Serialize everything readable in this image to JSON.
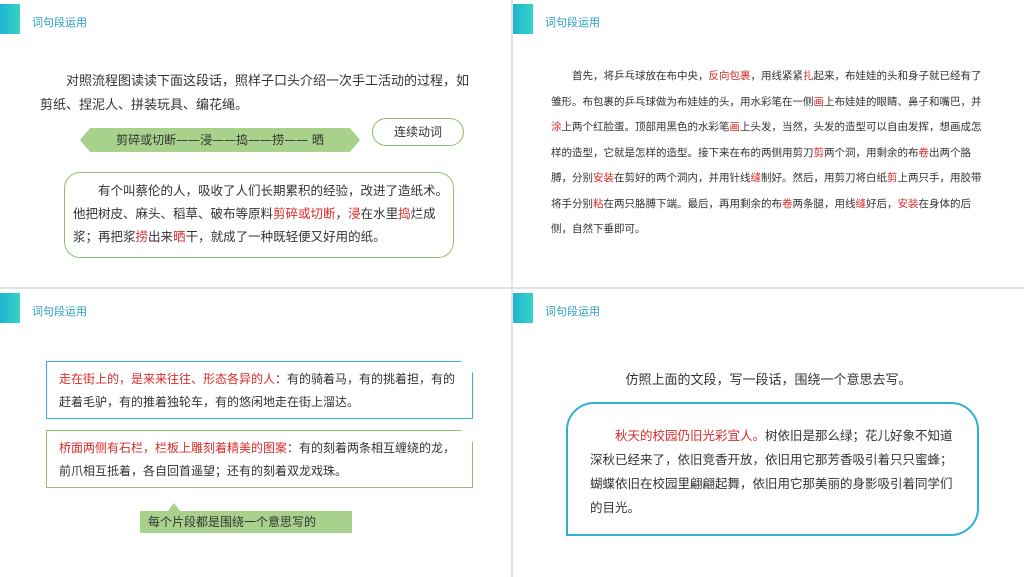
{
  "slide_title": "词句段运用",
  "s1": {
    "intro": "对照流程图读读下面这段话，照样子口头介绍一次手工活动的过程，如剪纸、捏泥人、拼装玩具、编花绳。",
    "flow": "剪碎或切断——浸——捣——捞—— 晒",
    "callout": "连续动词",
    "para": [
      {
        "t": "有个叫蔡伦的人，吸收了人们长期累积的经验，改进了造纸术。他把树皮、麻头、稻草、破布等原料",
        "r": false
      },
      {
        "t": "剪碎或切断",
        "r": true
      },
      {
        "t": "，",
        "r": false
      },
      {
        "t": "浸",
        "r": true
      },
      {
        "t": "在水里",
        "r": false
      },
      {
        "t": "捣",
        "r": true
      },
      {
        "t": "烂成浆；再把浆",
        "r": false
      },
      {
        "t": "捞",
        "r": true
      },
      {
        "t": "出来",
        "r": false
      },
      {
        "t": "晒",
        "r": true
      },
      {
        "t": "干，就成了一种既轻便又好用的纸。",
        "r": false
      }
    ]
  },
  "s2": {
    "para": [
      {
        "t": "首先，将乒乓球放在布中央，",
        "r": false
      },
      {
        "t": "反向包裹",
        "r": true
      },
      {
        "t": "，用线紧紧",
        "r": false
      },
      {
        "t": "扎",
        "r": true
      },
      {
        "t": "起来，布娃娃的头和身子就已经有了雏形。布包裹的乒乓球做为布娃娃的头，用水彩笔在一侧",
        "r": false
      },
      {
        "t": "画",
        "r": true
      },
      {
        "t": "上布娃娃的眼睛、鼻子和嘴巴，并",
        "r": false
      },
      {
        "t": "涂",
        "r": true
      },
      {
        "t": "上两个红脸蛋。顶部用黑色的水彩笔",
        "r": false
      },
      {
        "t": "画",
        "r": true
      },
      {
        "t": "上头发，当然，头发的造型可以自由发挥，想画成怎样的造型，它就是怎样的造型。接下来在布的两侧用剪刀",
        "r": false
      },
      {
        "t": "剪",
        "r": true
      },
      {
        "t": "两个洞，用剩余的布",
        "r": false
      },
      {
        "t": "卷",
        "r": true
      },
      {
        "t": "出两个胳膊，分别",
        "r": false
      },
      {
        "t": "安装",
        "r": true
      },
      {
        "t": "在剪好的两个洞内，并用针线",
        "r": false
      },
      {
        "t": "缝",
        "r": true
      },
      {
        "t": "制好。然后，用剪刀将白纸",
        "r": false
      },
      {
        "t": "剪",
        "r": true
      },
      {
        "t": "上两只手，用胶带将手分别",
        "r": false
      },
      {
        "t": "粘",
        "r": true
      },
      {
        "t": "在两只胳膊下端。最后，再用剩余的布",
        "r": false
      },
      {
        "t": "卷",
        "r": true
      },
      {
        "t": "两条腿，用线",
        "r": false
      },
      {
        "t": "缝",
        "r": true
      },
      {
        "t": "好后，",
        "r": false
      },
      {
        "t": "安装",
        "r": true
      },
      {
        "t": "在身体的后侧，自然下垂即可。",
        "r": false
      }
    ]
  },
  "s3": {
    "box1_red": "走在街上的，是来来往往、形态各异的人",
    "box1_rest": "：有的骑着马，有的挑着担，有的赶着毛驴，有的推着独轮车，有的悠闲地走在街上溜达。",
    "box2_red": "桥面两侧有石栏，栏板上雕刻着精美的图案",
    "box2_rest": "：有的刻着两条相互缠绕的龙，前爪相互抵着，各自回首遥望；还有的刻着双龙戏珠。",
    "note": "每个片段都是围绕一个意思写的"
  },
  "s4": {
    "prompt": "仿照上面的文段，写一段话，围绕一个意思去写。",
    "red": "秋天的校园仍旧光彩宜人。",
    "rest": "树依旧是那么绿；花儿好象不知道深秋已经来了，依旧竞香开放，依旧用它那芳香吸引着只只蜜蜂；蝴蝶依旧在校园里翩翩起舞，依旧用它那美丽的身影吸引着同学们的目光。"
  }
}
